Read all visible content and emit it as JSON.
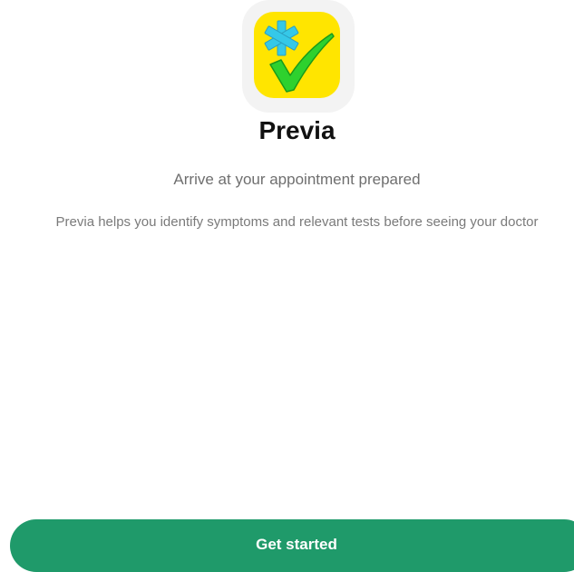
{
  "app": {
    "name": "Previa",
    "tagline": "Arrive at your appointment prepared",
    "description": "Previa helps you identify symptoms and relevant tests before seeing your doctor",
    "icon": "asterisk-checkmark-icon"
  },
  "cta": {
    "label": "Get started"
  },
  "colors": {
    "background": "#ffffff",
    "icon_background": "#ffe500",
    "asterisk": "#35c8e8",
    "checkmark": "#2ed12e",
    "button": "#1f9a6a",
    "button_text": "#ffffff"
  }
}
